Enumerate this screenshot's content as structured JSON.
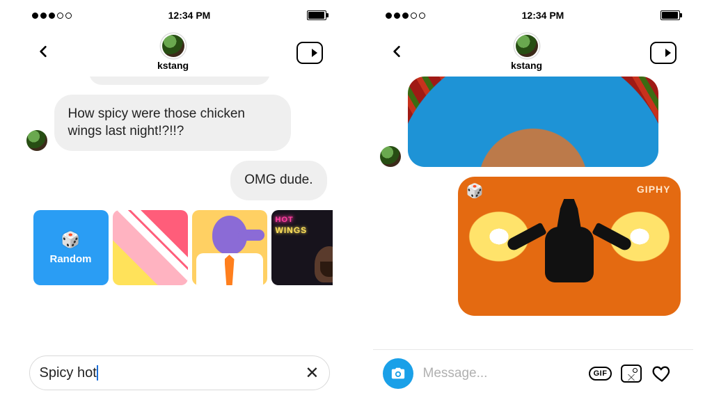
{
  "status": {
    "time": "12:34 PM"
  },
  "header": {
    "username": "kstang"
  },
  "left": {
    "incoming_message": "How spicy were those chicken wings last night!?!!?",
    "outgoing_message": "OMG dude.",
    "gif_tray": {
      "random_label": "Random",
      "tiles": [
        {
          "name": "random"
        },
        {
          "name": "abstract-pink-yellow"
        },
        {
          "name": "purple-cartoon-man"
        },
        {
          "name": "hot-wings-neon"
        }
      ],
      "tile3_text1": "HOT",
      "tile3_text2": "WINGS"
    },
    "search": {
      "value": "Spicy hot"
    }
  },
  "right": {
    "giphy_label": "GIPHY",
    "message_placeholder": "Message...",
    "gif_label": "GIF"
  }
}
